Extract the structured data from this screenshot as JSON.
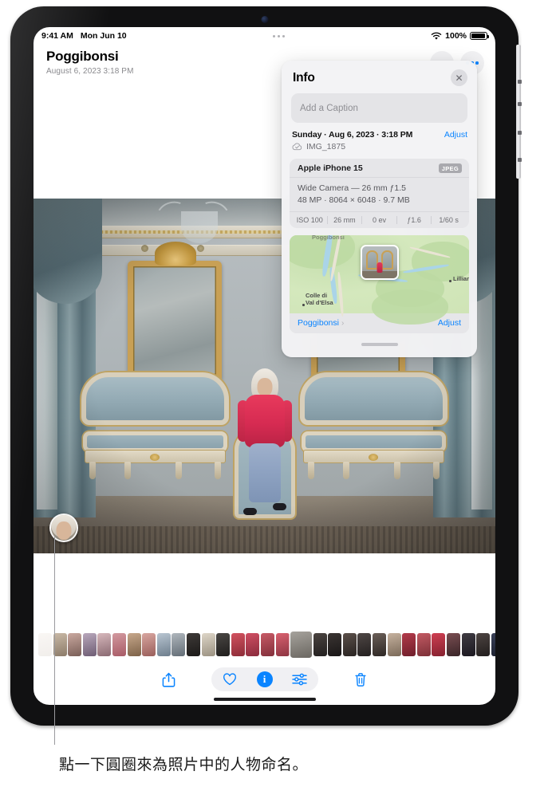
{
  "status_bar": {
    "time": "9:41 AM",
    "date": "Mon Jun 10",
    "wifi_icon": "wifi-icon",
    "battery_percent": "100%",
    "multitask_icon": "multitask-dots-icon"
  },
  "app_header": {
    "title": "Poggibonsi",
    "subtitle": "August 6, 2023  3:18 PM",
    "more_icon": "more-dots-icon"
  },
  "info_panel": {
    "title": "Info",
    "close_icon": "close-icon",
    "caption_placeholder": "Add a Caption",
    "date_line": "Sunday · Aug 6, 2023 · 3:18 PM",
    "date_adjust_label": "Adjust",
    "cloud_icon": "cloud-check-icon",
    "file_name": "IMG_1875",
    "camera": {
      "device": "Apple iPhone 15",
      "format_badge": "JPEG",
      "lens_line": "Wide Camera — 26 mm ƒ1.5",
      "specs_line": "48 MP · 8064 × 6048 · 9.7 MB",
      "exif": [
        "ISO 100",
        "26 mm",
        "0 ev",
        "ƒ1.6",
        "1/60 s"
      ]
    },
    "map": {
      "labels": [
        "Poggibonsi",
        "Colle di\nVal d'Elsa",
        "Lilliano"
      ],
      "place_link": "Poggibonsi",
      "chevron_icon": "chevron-right-icon",
      "adjust_label": "Adjust"
    }
  },
  "photo": {
    "face_circle_name": "face-detection-circle"
  },
  "toolbar": {
    "share_icon": "share-icon",
    "favorite_icon": "heart-icon",
    "info_icon": "info-icon",
    "adjust_icon": "adjust-sliders-icon",
    "delete_icon": "trash-icon"
  },
  "annotation": {
    "text": "點一下圓圈來為照片中的人物命名。"
  },
  "colors": {
    "accent": "#0a84ff",
    "panel_bg": "#f3f3f5",
    "card_bg": "#e6e6e9"
  },
  "filmstrip": {
    "thumbs": [
      {
        "a": "#efe7e0",
        "b": "#d8cfc6",
        "ghost": true
      },
      {
        "a": "#c9b9a6",
        "b": "#8c7b69"
      },
      {
        "a": "#caa9a0",
        "b": "#7a5f58"
      },
      {
        "a": "#b9a8bc",
        "b": "#6e5d74"
      },
      {
        "a": "#d7b8bc",
        "b": "#8a6a72"
      },
      {
        "a": "#d39aa0",
        "b": "#a85b66"
      },
      {
        "a": "#c7a88c",
        "b": "#7d6248"
      },
      {
        "a": "#d8a6a0",
        "b": "#9a5f5b"
      },
      {
        "a": "#b9c6d2",
        "b": "#6e7e8d"
      },
      {
        "a": "#b0b7bd",
        "b": "#636d76"
      },
      {
        "a": "#3e3a38",
        "b": "#1c1a19"
      },
      {
        "a": "#ded6c8",
        "b": "#9b9282"
      },
      {
        "a": "#4a4744",
        "b": "#201e1d"
      },
      {
        "a": "#d2525f",
        "b": "#8d2c38"
      },
      {
        "a": "#cf4f63",
        "b": "#8b2b3c"
      },
      {
        "a": "#c75a66",
        "b": "#83303b"
      },
      {
        "a": "#d8616f",
        "b": "#8e3542"
      },
      {
        "a": "#a6a39d",
        "b": "#6b6761",
        "current": true
      },
      {
        "a": "#4a4340",
        "b": "#232020"
      },
      {
        "a": "#3b3533",
        "b": "#1a1717"
      },
      {
        "a": "#5a4f49",
        "b": "#2a2422"
      },
      {
        "a": "#4f4745",
        "b": "#242020"
      },
      {
        "a": "#6b5f58",
        "b": "#2e2825"
      },
      {
        "a": "#c6b29f",
        "b": "#7b6a59"
      },
      {
        "a": "#b23a4a",
        "b": "#701f2b"
      },
      {
        "a": "#c25a63",
        "b": "#7d3038"
      },
      {
        "a": "#cf3f52",
        "b": "#85212f"
      },
      {
        "a": "#7a4e52",
        "b": "#3a2528"
      },
      {
        "a": "#3f3b42",
        "b": "#1b1820"
      },
      {
        "a": "#4d4442",
        "b": "#221e1d"
      },
      {
        "a": "#3a4158",
        "b": "#1a1e2c"
      },
      {
        "a": "#7b5f4c",
        "b": "#3a2c22"
      },
      {
        "a": "#8d6a52",
        "b": "#432f24"
      },
      {
        "a": "#b9a48e",
        "b": "#6d5d4c"
      },
      {
        "a": "#e6e2d2",
        "b": "#b5b09a",
        "ghost": true
      }
    ]
  }
}
